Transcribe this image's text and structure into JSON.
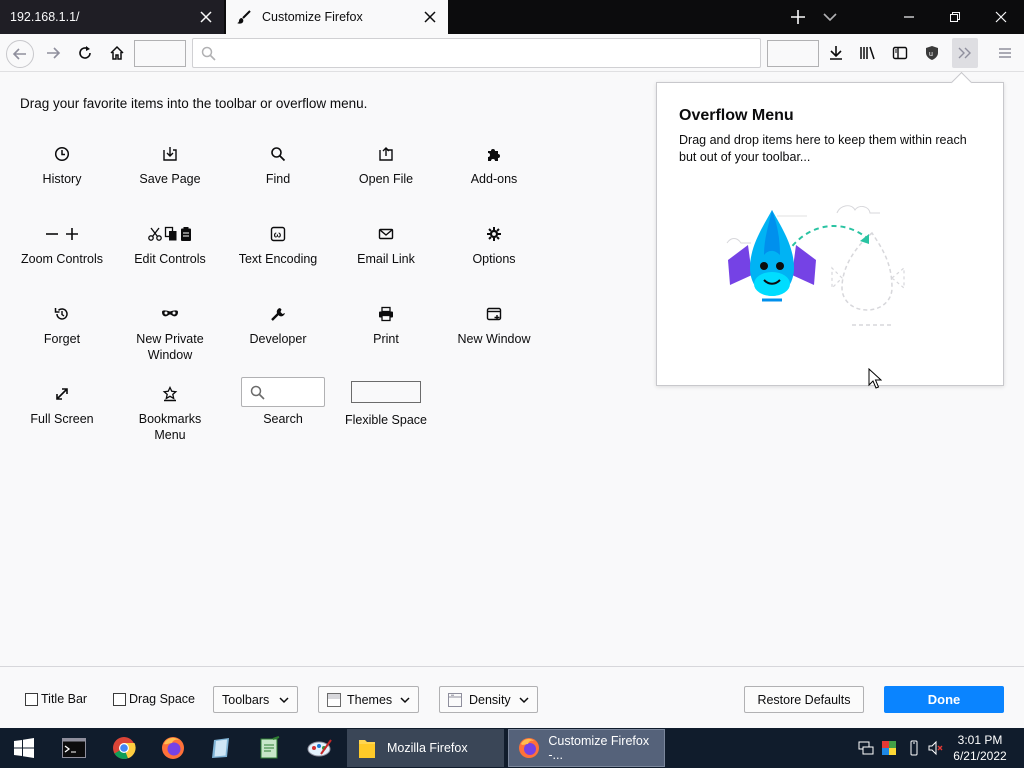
{
  "tabs": [
    {
      "title": "192.168.1.1/"
    },
    {
      "title": "Customize Firefox"
    }
  ],
  "instructions": "Drag your favorite items into the toolbar or overflow menu.",
  "palette": {
    "history": "History",
    "save_page": "Save Page",
    "find": "Find",
    "open_file": "Open File",
    "addons": "Add-ons",
    "zoom_controls": "Zoom Controls",
    "edit_controls": "Edit Controls",
    "text_encoding": "Text Encoding",
    "email_link": "Email Link",
    "options": "Options",
    "forget": "Forget",
    "new_private_window_1": "New Private",
    "new_private_window_2": "Window",
    "developer": "Developer",
    "print": "Print",
    "new_window": "New Window",
    "full_screen": "Full Screen",
    "bookmarks_menu_1": "Bookmarks",
    "bookmarks_menu_2": "Menu",
    "search": "Search",
    "flexible_space": "Flexible Space"
  },
  "overflow": {
    "title": "Overflow Menu",
    "description": "Drag and drop items here to keep them within reach but out of your toolbar..."
  },
  "bottom": {
    "title_bar": "Title Bar",
    "drag_space": "Drag Space",
    "toolbars": "Toolbars",
    "themes": "Themes",
    "density": "Density",
    "restore_defaults": "Restore Defaults",
    "done": "Done"
  },
  "taskbar": {
    "task1": "Mozilla Firefox",
    "task2": "Customize Firefox -...",
    "time": "3:01 PM",
    "date": "6/21/2022"
  },
  "colors": {
    "accent": "#0a84ff",
    "tabstrip": "#0c0c0d",
    "taskbar": "#101c2c"
  }
}
